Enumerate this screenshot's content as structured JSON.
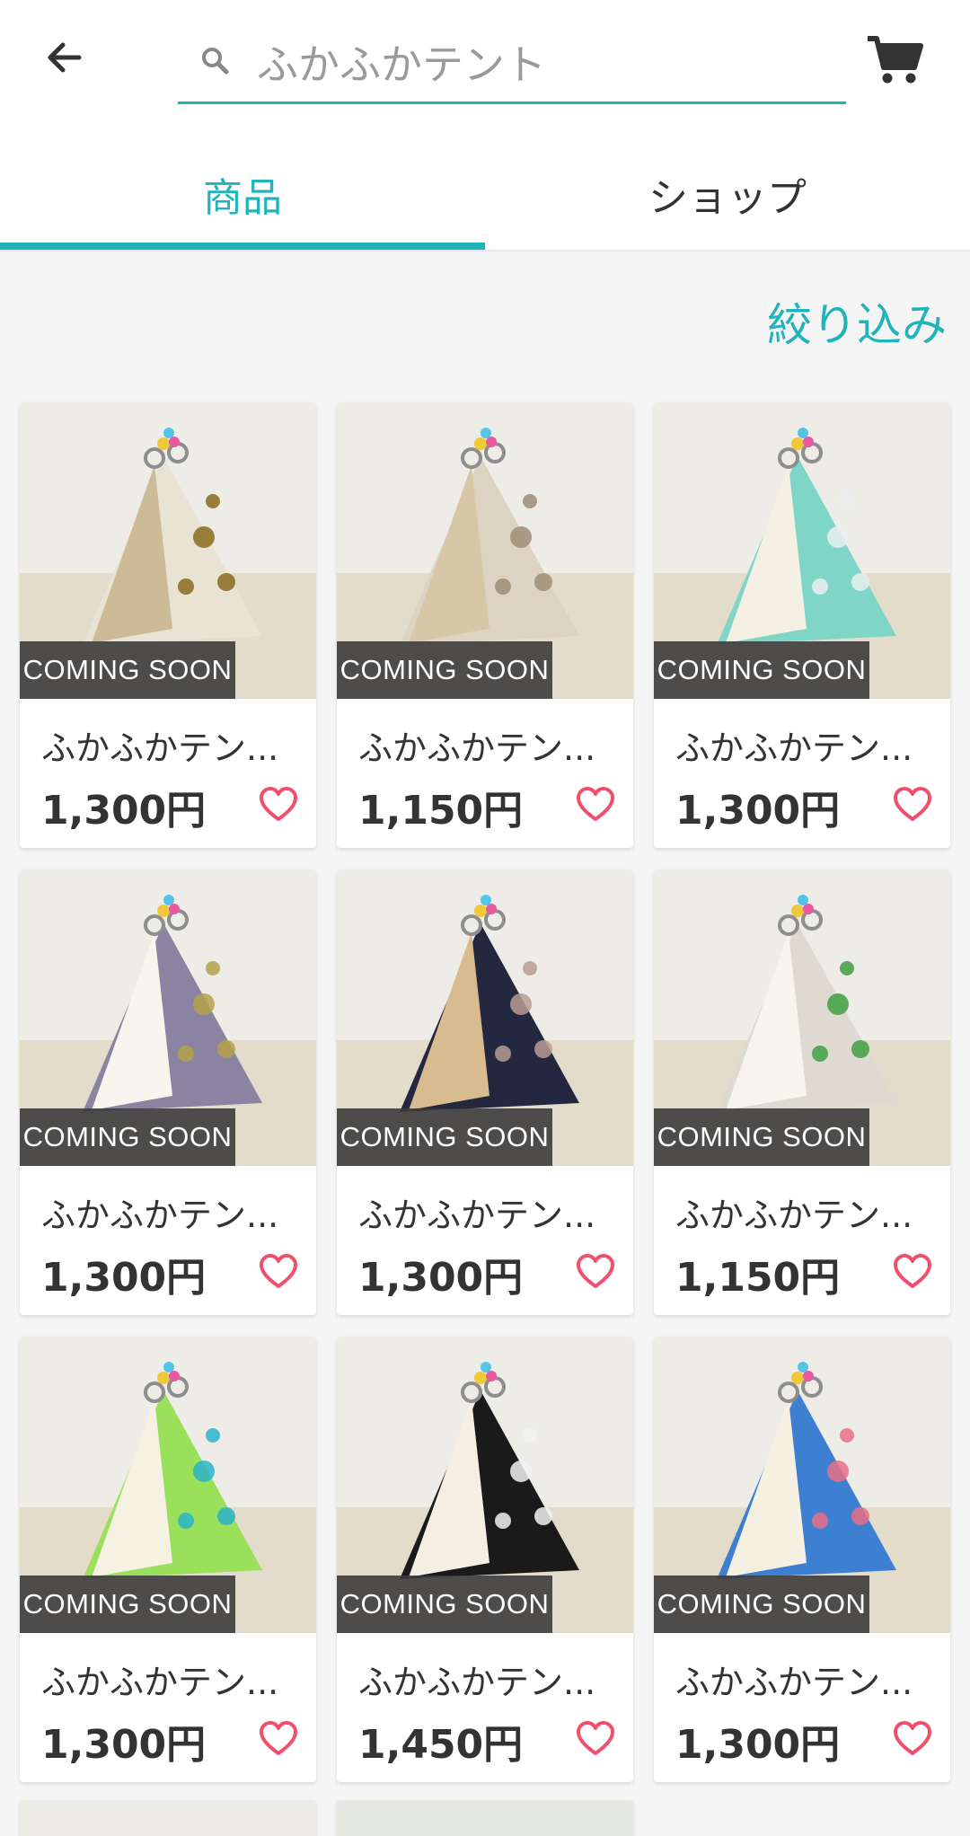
{
  "header": {
    "search": {
      "value": "ふかふかテント"
    }
  },
  "tabs": [
    {
      "label": "商品",
      "active": true
    },
    {
      "label": "ショップ",
      "active": false
    }
  ],
  "filter_label": "絞り込み",
  "accent_color": "#1fb3ba",
  "products": [
    {
      "badge": "COMING SOON",
      "title": "ふかふかテン...",
      "price": "1,300円",
      "fabric": "#e9e3d4",
      "pattern": "#8a6a1f",
      "lining": "#cdbb97"
    },
    {
      "badge": "COMING SOON",
      "title": "ふかふかテン...",
      "price": "1,150円",
      "fabric": "#ddd3c2",
      "pattern": "#9d8d77",
      "lining": "#d8c7a6"
    },
    {
      "badge": "COMING SOON",
      "title": "ふかふかテン...",
      "price": "1,300円",
      "fabric": "#7fd6c6",
      "pattern": "#e9eef0",
      "lining": "#f4f0e4"
    },
    {
      "badge": "COMING SOON",
      "title": "ふかふかテン...",
      "price": "1,300円",
      "fabric": "#8a83a2",
      "pattern": "#b4a24a",
      "lining": "#f7f5ee"
    },
    {
      "badge": "COMING SOON",
      "title": "ふかふかテン...",
      "price": "1,300円",
      "fabric": "#23273f",
      "pattern": "#b99d93",
      "lining": "#d8bb8e"
    },
    {
      "badge": "COMING SOON",
      "title": "ふかふかテン...",
      "price": "1,150円",
      "fabric": "#dedad1",
      "pattern": "#3f9f43",
      "lining": "#f6f4ec"
    },
    {
      "badge": "COMING SOON",
      "title": "ふかふかテン...",
      "price": "1,300円",
      "fabric": "#9be05a",
      "pattern": "#2bb3c9",
      "lining": "#f5f1e3"
    },
    {
      "badge": "COMING SOON",
      "title": "ふかふかテン...",
      "price": "1,450円",
      "fabric": "#1a1a1a",
      "pattern": "#f2f2f2",
      "lining": "#f4efe2"
    },
    {
      "badge": "COMING SOON",
      "title": "ふかふかテン...",
      "price": "1,300円",
      "fabric": "#3d7fd1",
      "pattern": "#e96f86",
      "lining": "#f5f0e2"
    }
  ]
}
